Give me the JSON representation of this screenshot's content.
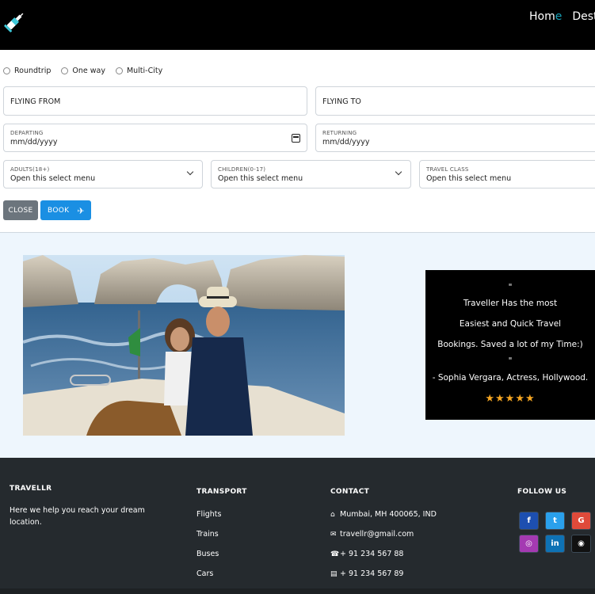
{
  "nav": {
    "logo_icon": "syringe-icon",
    "home_prefix": "Hom",
    "home_accent": "e",
    "destinations": "Desti"
  },
  "booking": {
    "trip_types": [
      "Roundtrip",
      "One way",
      "Multi-City"
    ],
    "flying_from": {
      "placeholder": "FLYING FROM"
    },
    "flying_to": {
      "placeholder": "FLYING TO"
    },
    "departing": {
      "label": "DEPARTING",
      "value": "mm/dd/yyyy"
    },
    "returning": {
      "label": "RETURNING",
      "value": "mm/dd/yyyy"
    },
    "adults": {
      "label": "ADULTS(18+)",
      "value": "Open this select menu"
    },
    "children": {
      "label": "CHILDREN(0-17)",
      "value": "Open this select menu"
    },
    "travel_class": {
      "label": "TRAVEL CLASS",
      "value": "Open this select menu"
    },
    "close_label": "CLOSE",
    "book_label": "BOOK"
  },
  "testimonial": {
    "lines": [
      "\"",
      "Traveller Has the most",
      "Easiest and Quick Travel",
      "Bookings. Saved a lot of my Time:)",
      "\"",
      "- Sophia Vergara, Actress, Hollywood."
    ],
    "stars": "★★★★★",
    "rating": 5
  },
  "footer": {
    "brand": {
      "title": "TRAVELLR",
      "text": "Here we help you reach your dream location."
    },
    "transport": {
      "title": "TRANSPORT",
      "links": [
        "Flights",
        "Trains",
        "Buses",
        "Cars"
      ]
    },
    "contact": {
      "title": "CONTACT",
      "items": [
        {
          "icon": "home-icon",
          "text": "Mumbai, MH 400065, IND"
        },
        {
          "icon": "envelope-icon",
          "text": "travellr@gmail.com"
        },
        {
          "icon": "phone-icon",
          "text": "+ 91 234 567 88"
        },
        {
          "icon": "fax-icon",
          "text": "+ 91 234 567 89"
        }
      ]
    },
    "follow": {
      "title": "FOLLOW US",
      "icons": [
        "facebook-icon",
        "twitter-icon",
        "google-icon",
        "instagram-icon",
        "linkedin-icon",
        "github-icon"
      ],
      "glyphs": [
        "f",
        "t",
        "G",
        "◎",
        "in",
        "◉"
      ]
    }
  },
  "colors": {
    "navbar": "#000000",
    "accent": "#17a2b8",
    "book_button": "#1a8fe3",
    "close_button": "#6c757d",
    "footer": "#252a2e",
    "star": "#f5a623",
    "section_bg": "#eef6fd"
  }
}
